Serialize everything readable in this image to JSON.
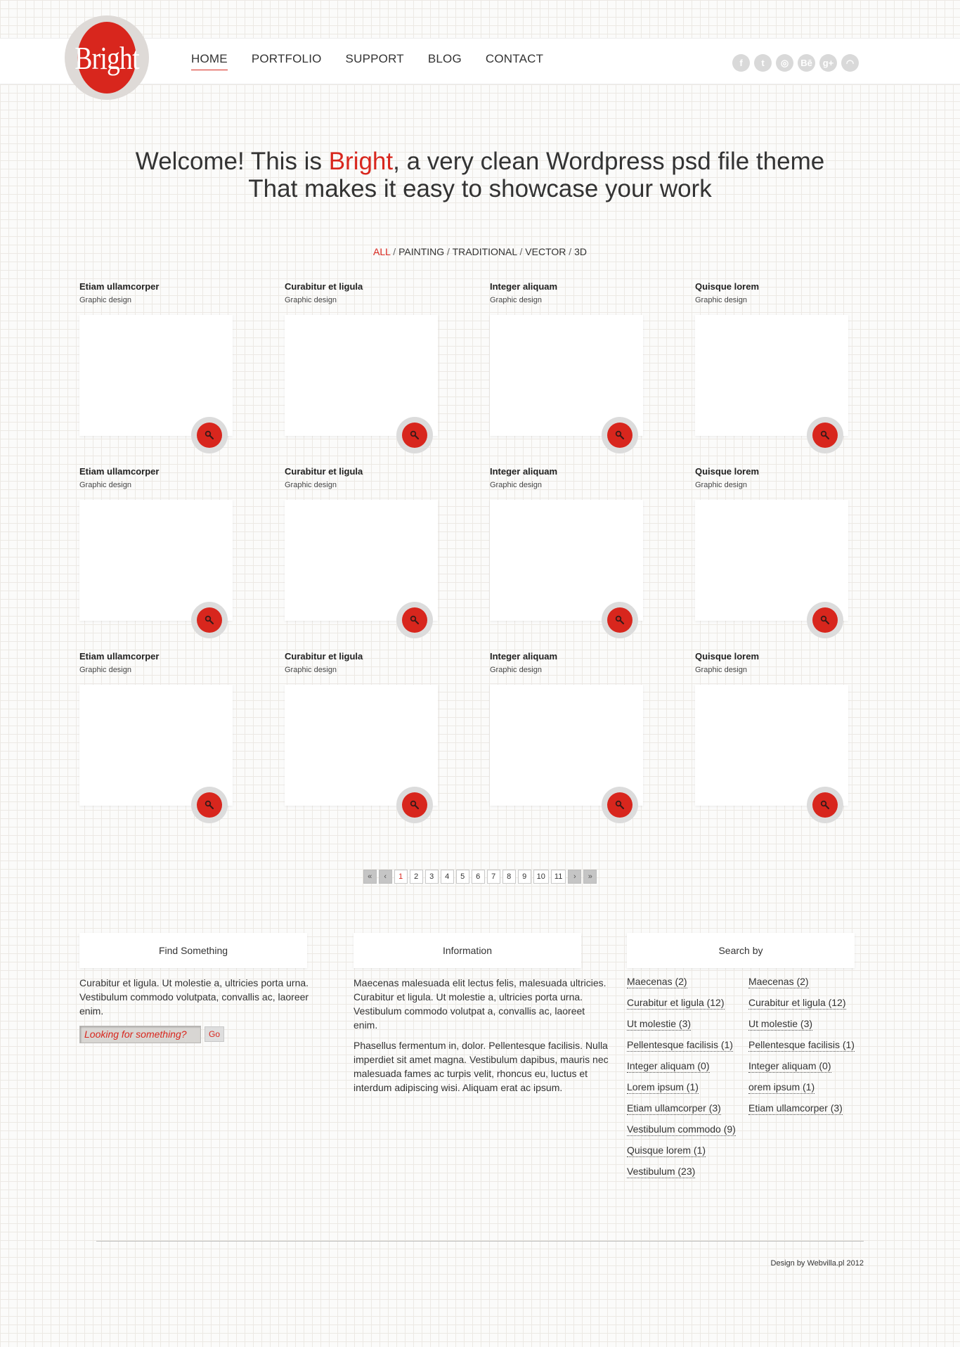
{
  "brand": {
    "logo_text": "Bright",
    "accent_color": "#d8261d"
  },
  "nav": [
    {
      "label": "HOME",
      "active": true
    },
    {
      "label": "PORTFOLIO",
      "active": false
    },
    {
      "label": "SUPPORT",
      "active": false
    },
    {
      "label": "BLOG",
      "active": false
    },
    {
      "label": "CONTACT",
      "active": false
    }
  ],
  "social": [
    {
      "icon": "facebook-icon",
      "glyph": "f"
    },
    {
      "icon": "twitter-icon",
      "glyph": "t"
    },
    {
      "icon": "dribbble-icon",
      "glyph": "◎"
    },
    {
      "icon": "behance-icon",
      "glyph": "Bē"
    },
    {
      "icon": "google-plus-icon",
      "glyph": "g+"
    },
    {
      "icon": "rss-icon",
      "glyph": "◠"
    }
  ],
  "hero": {
    "pre": "Welcome! This is ",
    "accent": "Bright",
    "post": ", a very clean Wordpress psd file theme",
    "line2": "That makes it easy to showcase your work"
  },
  "filters": [
    "ALL",
    "PAINTING",
    "TRADITIONAL",
    "VECTOR",
    "3D"
  ],
  "portfolio": [
    {
      "title": "Etiam ullamcorper",
      "category": "Graphic design"
    },
    {
      "title": "Curabitur et ligula",
      "category": "Graphic design"
    },
    {
      "title": "Integer aliquam",
      "category": "Graphic design"
    },
    {
      "title": "Quisque lorem",
      "category": "Graphic design"
    },
    {
      "title": "Etiam ullamcorper",
      "category": "Graphic design"
    },
    {
      "title": "Curabitur et ligula",
      "category": "Graphic design"
    },
    {
      "title": "Integer aliquam",
      "category": "Graphic design"
    },
    {
      "title": "Quisque lorem",
      "category": "Graphic design"
    },
    {
      "title": "Etiam ullamcorper",
      "category": "Graphic design"
    },
    {
      "title": "Curabitur et ligula",
      "category": "Graphic design"
    },
    {
      "title": "Integer aliquam",
      "category": "Graphic design"
    },
    {
      "title": "Quisque lorem",
      "category": "Graphic design"
    }
  ],
  "pagination": {
    "first": "«",
    "prev": "‹",
    "next": "›",
    "last": "»",
    "pages": [
      "1",
      "2",
      "3",
      "4",
      "5",
      "6",
      "7",
      "8",
      "9",
      "10",
      "11"
    ],
    "current": "1"
  },
  "widgets": {
    "find": {
      "title": "Find Something",
      "text": "Curabitur et ligula. Ut molestie a, ultricies porta urna. Vestibulum commodo volutpata, convallis ac, laoreer enim.",
      "search_placeholder": "Looking for something?",
      "go_label": "Go"
    },
    "info": {
      "title": "Information",
      "p1": "Maecenas malesuada elit lectus felis, malesuada ultricies. Curabitur et ligula. Ut molestie a, ultricies porta urna. Vestibulum commodo volutpat a, convallis ac, laoreet enim.",
      "p2": "Phasellus fermentum in, dolor. Pellentesque facilisis. Nulla imperdiet sit amet magna. Vestibulum dapibus, mauris nec malesuada fames ac turpis velit, rhoncus eu, luctus et interdum adipiscing wisi. Aliquam erat ac ipsum."
    },
    "search_by": {
      "title": "Search by",
      "col1": [
        "Maecenas (2)",
        "Curabitur et ligula (12)",
        "Ut molestie (3)",
        "Pellentesque facilisis (1)",
        "Integer aliquam (0)",
        "Lorem ipsum (1)",
        "Etiam ullamcorper (3)",
        "Vestibulum commodo (9)",
        "Quisque lorem (1)",
        "Vestibulum (23)"
      ],
      "col2": [
        "Maecenas (2)",
        "Curabitur et ligula (12)",
        "Ut molestie (3)",
        "Pellentesque facilisis (1)",
        "Integer aliquam (0)",
        "orem ipsum (1)",
        "Etiam ullamcorper (3)"
      ]
    }
  },
  "footer": {
    "credit": "Design by Webvilla.pl 2012"
  }
}
